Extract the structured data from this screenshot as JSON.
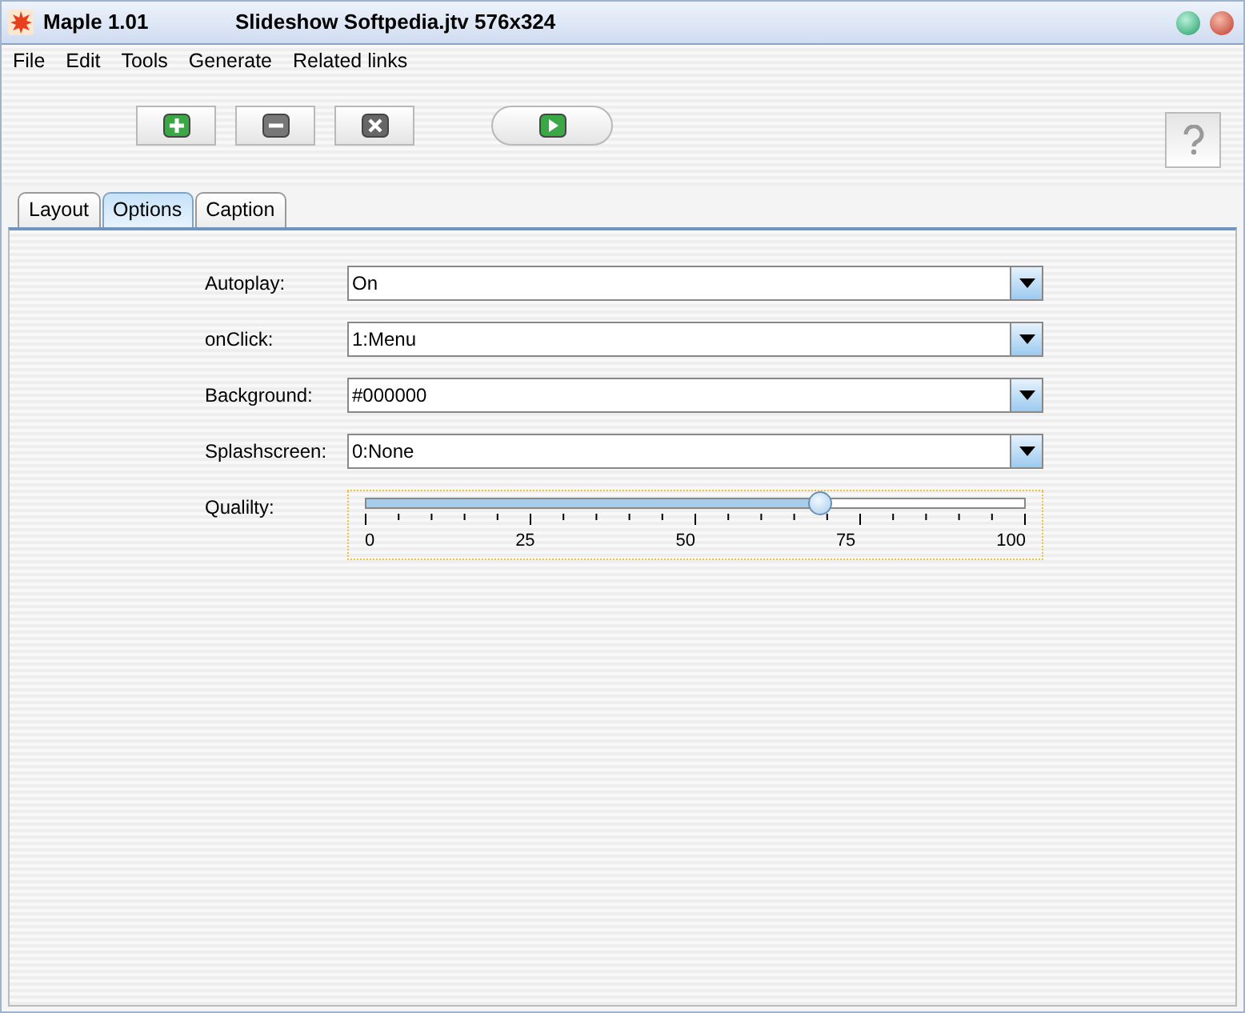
{
  "window": {
    "app_title": "Maple 1.01",
    "document_title": "Slideshow Softpedia.jtv 576x324"
  },
  "menu": [
    "File",
    "Edit",
    "Tools",
    "Generate",
    "Related links"
  ],
  "tabs": [
    {
      "label": "Layout",
      "selected": false
    },
    {
      "label": "Options",
      "selected": true
    },
    {
      "label": "Caption",
      "selected": false
    }
  ],
  "fields": [
    {
      "label": "Autoplay:",
      "value": "On"
    },
    {
      "label": "onClick:",
      "value": "1:Menu"
    },
    {
      "label": "Background:",
      "value": "#000000"
    },
    {
      "label": "Splashscreen:",
      "value": "0:None"
    }
  ],
  "quality": {
    "label": "Qualilty:",
    "level": 0.69,
    "tick_labels": [
      "0",
      "25",
      "50",
      "75",
      "100"
    ]
  }
}
